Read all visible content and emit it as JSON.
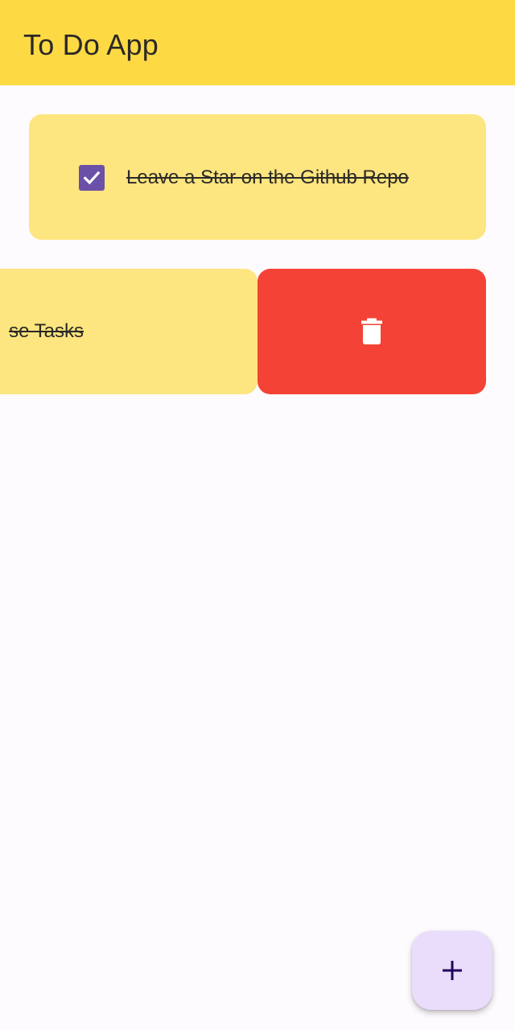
{
  "app_bar": {
    "title": "To Do App",
    "background_color": "#fdd944"
  },
  "tasks": [
    {
      "label": "Leave a Star on the Github Repo",
      "completed": true,
      "visible_text": "Leave a Star on the Github Repo"
    },
    {
      "visible_text": "se Tasks",
      "completed": true,
      "swiped": true
    }
  ],
  "delete_action": {
    "icon": "trash-icon",
    "color": "#f44336"
  },
  "fab": {
    "icon": "plus-icon",
    "color": "#eadcfb"
  },
  "colors": {
    "card": "#fde57f",
    "checkbox": "#6a50a7",
    "background": "#fefbfe"
  }
}
